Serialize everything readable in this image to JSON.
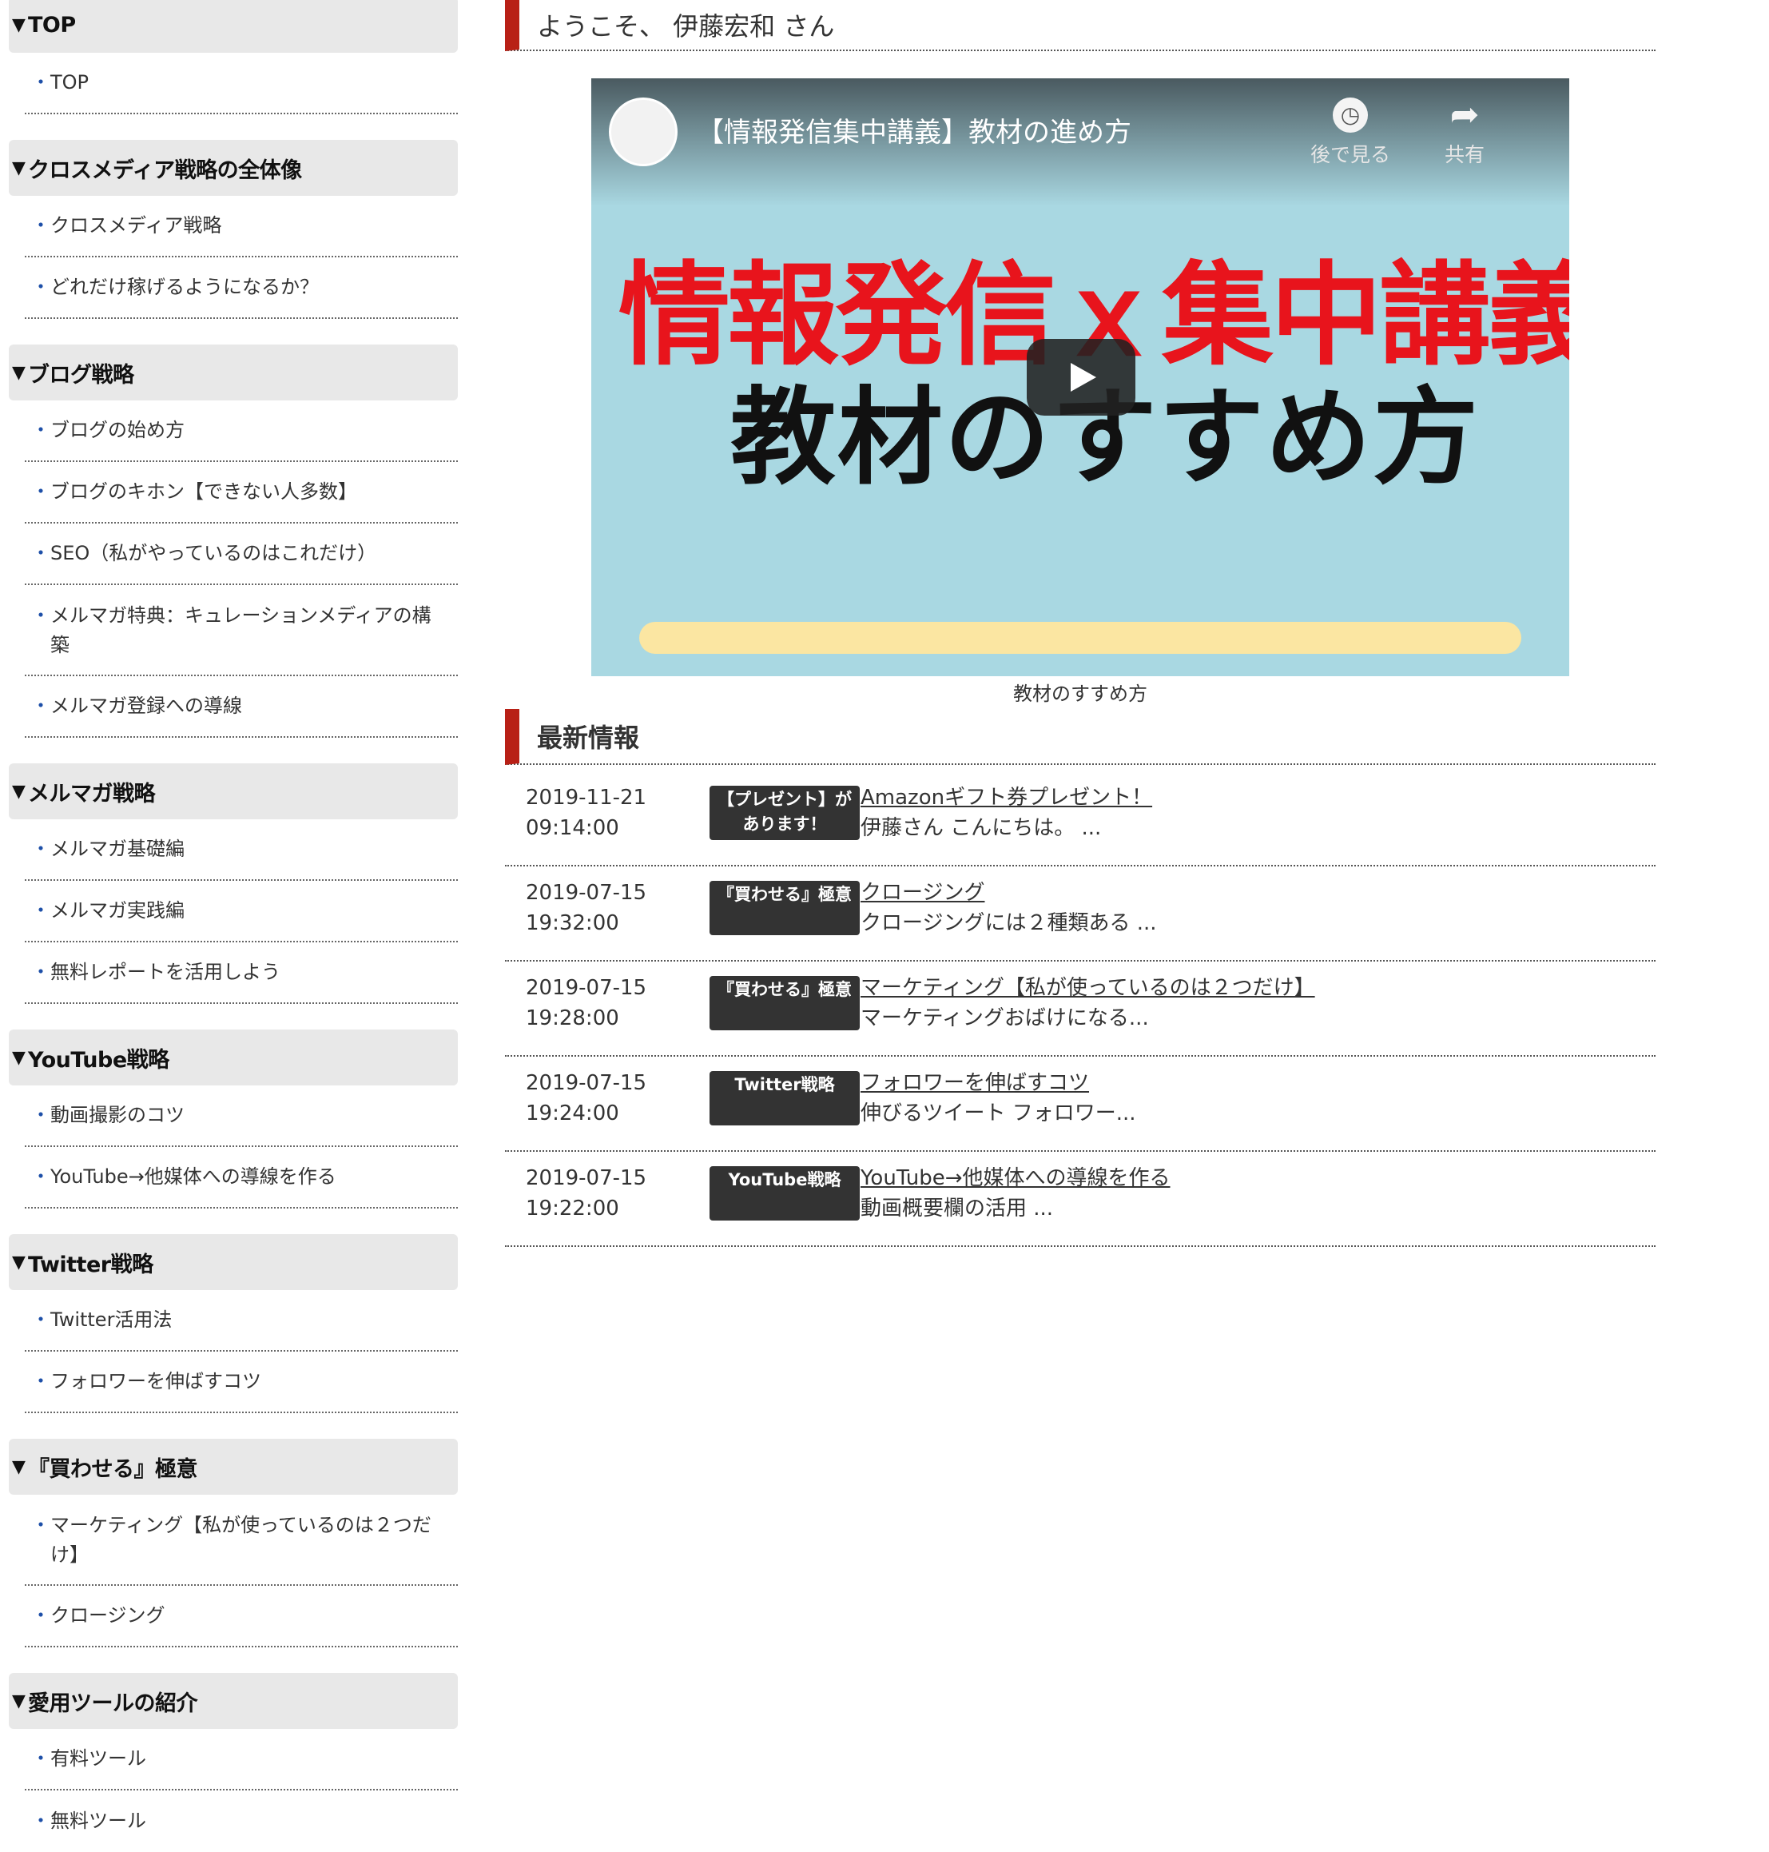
{
  "sidebar": {
    "categories": [
      {
        "title": "TOP",
        "items": [
          "TOP"
        ]
      },
      {
        "title": "クロスメディア戦略の全体像",
        "items": [
          "クロスメディア戦略",
          "どれだけ稼げるようになるか？"
        ]
      },
      {
        "title": "ブログ戦略",
        "items": [
          "ブログの始め方",
          "ブログのキホン【できない人多数】",
          "SEO（私がやっているのはこれだけ）",
          "メルマガ特典：キュレーションメディアの構築",
          "メルマガ登録への導線"
        ]
      },
      {
        "title": "メルマガ戦略",
        "items": [
          "メルマガ基礎編",
          "メルマガ実践編",
          "無料レポートを活用しよう"
        ]
      },
      {
        "title": "YouTube戦略",
        "items": [
          "動画撮影のコツ",
          "YouTube→他媒体への導線を作る"
        ]
      },
      {
        "title": "Twitter戦略",
        "items": [
          "Twitter活用法",
          "フォロワーを伸ばすコツ"
        ]
      },
      {
        "title": "『買わせる』極意",
        "items": [
          "マーケティング【私が使っているのは２つだけ】",
          "クロージング"
        ]
      },
      {
        "title": "愛用ツールの紹介",
        "items": [
          "有料ツール",
          "無料ツール"
        ]
      }
    ],
    "triangle": "▼",
    "bullet": "・"
  },
  "welcome": {
    "text": "ようこそ、 伊藤宏和 さん"
  },
  "video": {
    "title": "【情報発信集中講義】教材の進め方",
    "watch_later_label": "後で見る",
    "share_label": "共有",
    "thumb_line1": "情報発信ｘ集中講義",
    "thumb_line2": "教材のすすめ方",
    "caption": "教材のすすめ方",
    "icons": {
      "watch_later": "clock-icon",
      "share": "share-arrow-icon",
      "play": "play-icon"
    }
  },
  "latest": {
    "title": "最新情報",
    "items": [
      {
        "date": "2019-11-21",
        "time": "09:14:00",
        "tag": "【プレゼント】があります！",
        "title": "Amazonギフト券プレゼント！",
        "excerpt": "伊藤さん こんにちは。 ..."
      },
      {
        "date": "2019-07-15",
        "time": "19:32:00",
        "tag": "『買わせる』極意",
        "title": "クロージング",
        "excerpt": "クロージングには２種類ある ..."
      },
      {
        "date": "2019-07-15",
        "time": "19:28:00",
        "tag": "『買わせる』極意",
        "title": "マーケティング【私が使っているのは２つだけ】",
        "excerpt": "マーケティングおばけになる..."
      },
      {
        "date": "2019-07-15",
        "time": "19:24:00",
        "tag": "Twitter戦略",
        "title": "フォロワーを伸ばすコツ",
        "excerpt": "伸びるツイート フォロワー..."
      },
      {
        "date": "2019-07-15",
        "time": "19:22:00",
        "tag": "YouTube戦略",
        "title": "YouTube→他媒体への導線を作る",
        "excerpt": "動画概要欄の活用 ..."
      }
    ]
  },
  "colors": {
    "accent": "#b82016",
    "bullet": "#1d4fa8",
    "tag_bg": "#333333",
    "category_bg": "#e8e8e8"
  }
}
